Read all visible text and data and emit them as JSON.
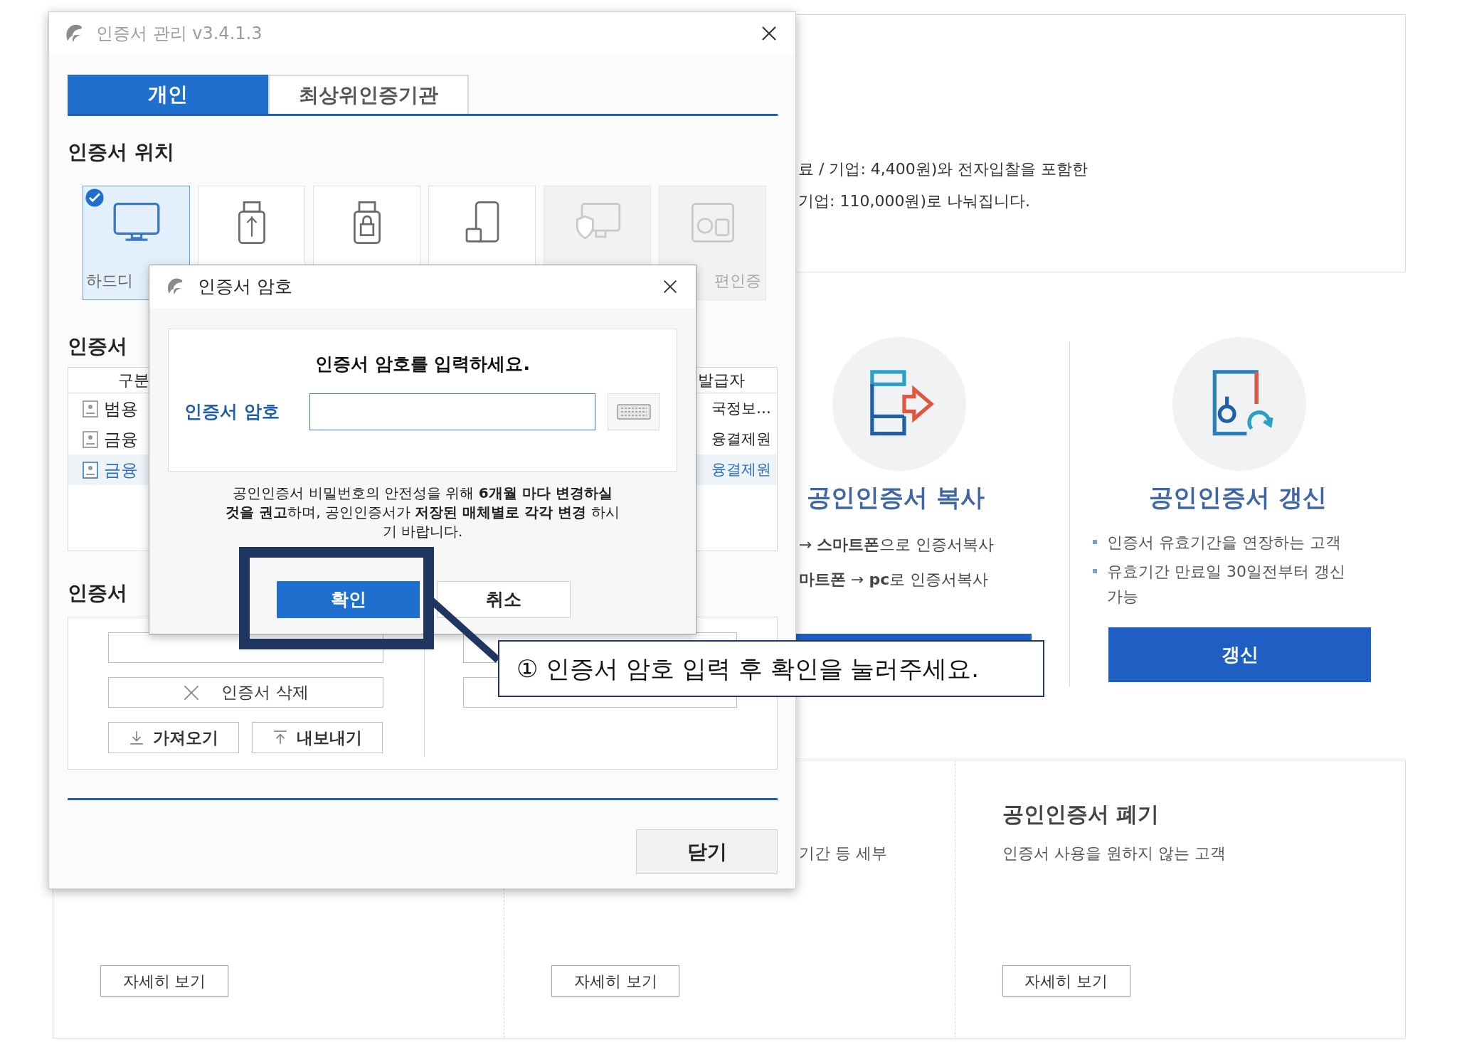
{
  "page": {
    "intro_lines": [
      "료 / 기업: 4,400원)와 전자입찰을 포함한",
      "기업: 110,000원)로 나눠집니다."
    ],
    "copy": {
      "title": "공인인증서 복사",
      "lines": [
        "→ **스마트폰**으로 인증서복사",
        "**마트폰** → **pc**로 인증서복사"
      ]
    },
    "renew": {
      "title": "공인인증서 갱신",
      "bullets": [
        "인증서 유효기간을 연장하는 고객",
        "유효기간 만료일 30일전부터 갱신 가능"
      ],
      "button": "갱신"
    },
    "columns": [
      {
        "button": "자세히 보기"
      },
      {
        "text": "기간 등 세부",
        "button": "자세히 보기"
      },
      {
        "title": "공인인증서 폐기",
        "text": "인증서 사용을 원하지 않는 고객",
        "button": "자세히 보기"
      }
    ]
  },
  "cert_window": {
    "title": "인증서 관리 v3.4.1.3",
    "tabs": [
      {
        "label": "개인",
        "selected": true
      },
      {
        "label": "최상위인증기관",
        "selected": false
      }
    ],
    "location_heading": "인증서 위치",
    "locations": [
      {
        "label": "하드디",
        "selected": true,
        "disabled": false
      },
      {
        "selected": false,
        "disabled": false
      },
      {
        "selected": false,
        "disabled": false
      },
      {
        "selected": false,
        "disabled": false
      },
      {
        "selected": false,
        "disabled": true
      },
      {
        "label": "편인증",
        "selected": false,
        "disabled": true
      }
    ],
    "list_heading": "인증서",
    "table": {
      "columns": [
        "구분",
        "발급자"
      ],
      "rows": [
        {
          "type": "범용",
          "issuer": "국정보…",
          "selected": false
        },
        {
          "type": "금융",
          "issuer": "융결제원",
          "selected": false
        },
        {
          "type": "금융",
          "issuer": "융결제원",
          "selected": true
        }
      ]
    },
    "manage_heading": "인증서",
    "manage_buttons": [
      {
        "label": "인증서 삭제",
        "kind": "delete"
      },
      {
        "label": "가져오기",
        "kind": "import"
      },
      {
        "label": "내보내기",
        "kind": "export"
      }
    ],
    "close_button": "닫기"
  },
  "password_dialog": {
    "title": "인증서 암호",
    "prompt": "인증서 암호를 입력하세요.",
    "field_label": "인증서 암호",
    "notice": "공인인증서 비밀번호의 안전성을 위해 **6개월 마다 변경하실 것을 권고**하며, 공인인증서가 **저장된 매체별로 각각 변경** 하시기 바랍니다.",
    "buttons": [
      {
        "label": "확인",
        "kind": "primary"
      },
      {
        "label": "취소",
        "kind": "secondary"
      }
    ]
  },
  "annotation": {
    "text": "① 인증서 암호 입력 후 확인을 눌러주세요."
  }
}
